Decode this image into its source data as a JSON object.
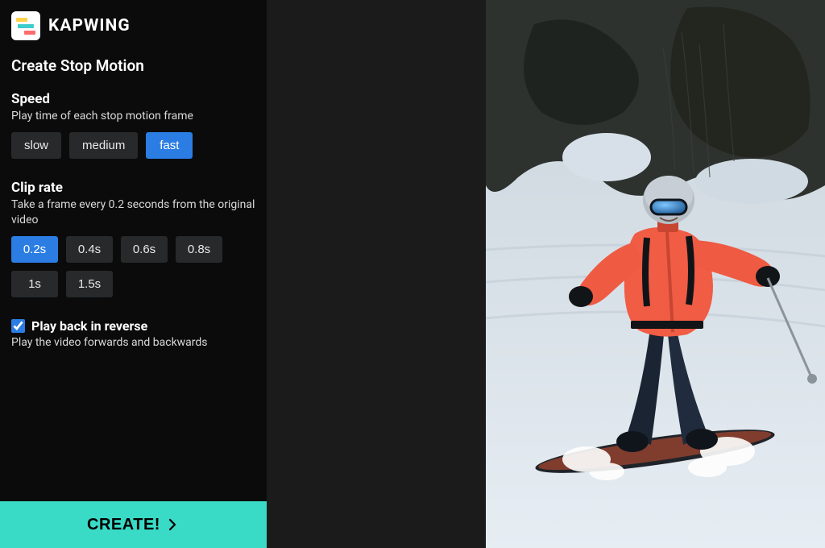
{
  "brand": {
    "name": "KAPWING"
  },
  "page": {
    "title": "Create Stop Motion"
  },
  "sections": {
    "speed": {
      "heading": "Speed",
      "desc": "Play time of each stop motion frame",
      "options": [
        "slow",
        "medium",
        "fast"
      ],
      "selected": "fast"
    },
    "clipRate": {
      "heading": "Clip rate",
      "desc": "Take a frame every 0.2 seconds from the original video",
      "options": [
        "0.2s",
        "0.4s",
        "0.6s",
        "0.8s",
        "1s",
        "1.5s"
      ],
      "selected": "0.2s"
    },
    "reverse": {
      "label": "Play back in reverse",
      "desc": "Play the video forwards and backwards",
      "checked": true
    }
  },
  "actions": {
    "create": "CREATE!"
  },
  "preview": {
    "description": "snowboarder-in-orange-jacket",
    "colors": {
      "sky": "#b0bcc3",
      "snow": "#dbe3ea",
      "snow_shadow": "#c4cfd8",
      "rock_dark": "#2a2d2b",
      "rock_mid": "#4a4f4c",
      "tree": "#1e241e",
      "jacket": "#f05c44",
      "jacket_shadow": "#c84631",
      "pants": "#1b2433",
      "helmet": "#b8bfc6",
      "goggles": "#2a6fae",
      "board": "#2a2c2e",
      "board_accent": "#d05232",
      "gloves": "#111417",
      "pole": "#9aa4ab"
    }
  }
}
